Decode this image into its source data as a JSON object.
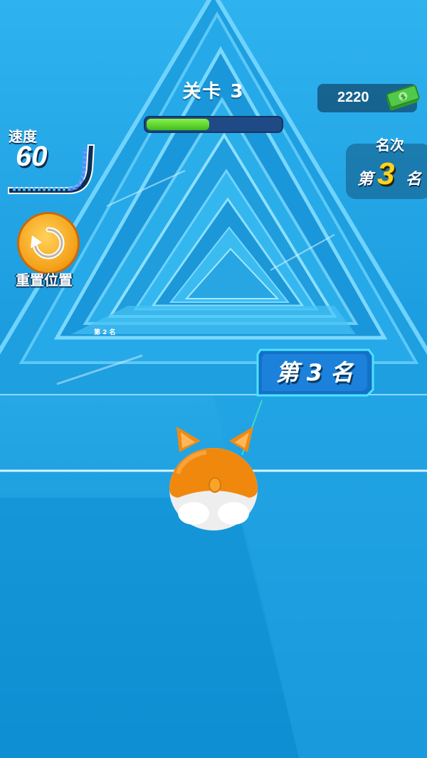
{
  "level": {
    "label": "关卡 3",
    "progress_fraction": 0.47
  },
  "money": {
    "value": "2220",
    "icon": "cash-icon"
  },
  "speed": {
    "label": "速度",
    "value": "60"
  },
  "rank": {
    "label": "名次",
    "prefix": "第",
    "number": "3",
    "suffix": "名"
  },
  "reset": {
    "label": "重置位置",
    "icon": "reset-arrow-icon"
  },
  "player_tag": {
    "text": "第 3 名"
  },
  "opponent_tag": {
    "text": "第 2 名"
  },
  "colors": {
    "accent_yellow": "#ffd21c",
    "progress_green": "#5fd12b",
    "track_blue": "#1aa6e8",
    "button_orange": "#f5a21a"
  }
}
